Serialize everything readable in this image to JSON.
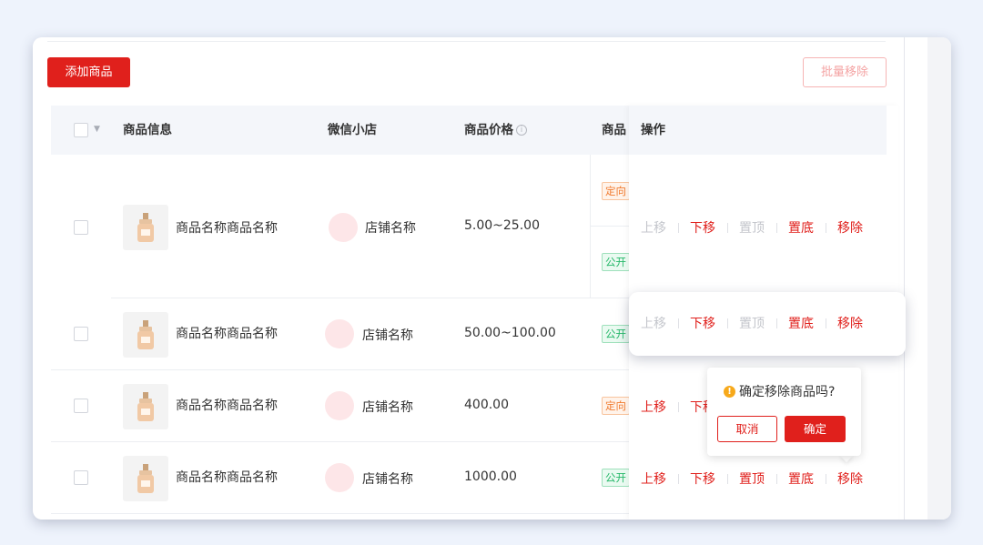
{
  "toolbar": {
    "add_label": "添加商品",
    "batch_remove_label": "批量移除"
  },
  "table": {
    "columns": [
      "商品信息",
      "微信小店",
      "商品价格",
      "商品",
      "操作"
    ],
    "rows": [
      {
        "name": "商品名称商品名称",
        "shop": "店铺名称",
        "price": "5.00~25.00",
        "tags": [
          "定向",
          "公开"
        ]
      },
      {
        "name": "商品名称商品名称",
        "shop": "店铺名称",
        "price": "50.00~100.00",
        "tags": [
          "公开"
        ]
      },
      {
        "name": "商品名称商品名称",
        "shop": "店铺名称",
        "price": "400.00",
        "tags": [
          "定向"
        ]
      },
      {
        "name": "商品名称商品名称",
        "shop": "店铺名称",
        "price": "1000.00",
        "tags": [
          "公开"
        ]
      }
    ],
    "ops": {
      "move_up": "上移",
      "move_down": "下移",
      "pin_top": "置顶",
      "pin_bottom": "置底",
      "remove": "移除"
    }
  },
  "popconfirm": {
    "message": "确定移除商品吗?",
    "cancel": "取消",
    "confirm": "确定"
  },
  "icons": {
    "warning": "warning-icon",
    "info": "info-icon",
    "caret": "caret-down-icon",
    "product": "perfume-bottle-icon"
  },
  "colors": {
    "primary": "#e0201c",
    "tag_orange": "#f07a2e",
    "tag_green": "#27b86a",
    "warning": "#f7a91b"
  }
}
